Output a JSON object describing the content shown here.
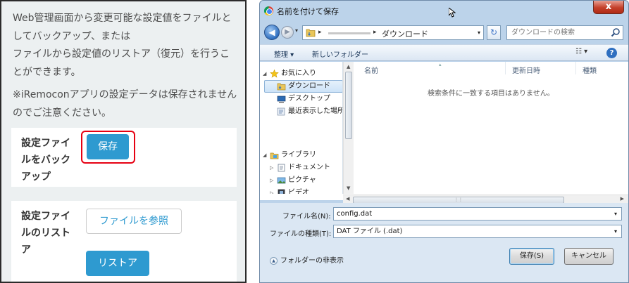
{
  "left": {
    "description_1": "Web管理画面から変更可能な設定値をファイルとしてバックアップ、または\nファイルから設定値のリストア（復元）を行うことができます。",
    "description_2": "※iRemoconアプリの設定データは保存されませんのでご注意ください。",
    "backup": {
      "label": "設定ファイ\nルをバック\nアップ",
      "save_button": "保存"
    },
    "restore": {
      "label": "設定ファイ\nルのリスト\nア",
      "browse_button": "ファイルを参照",
      "restore_button": "リストア"
    },
    "colors": {
      "accent": "#2e9ad0",
      "highlight": "#e60012"
    }
  },
  "dialog": {
    "title": "名前を付けて保存",
    "close_label": "x",
    "address": {
      "current": "ダウンロード"
    },
    "search_placeholder": "ダウンロードの検索",
    "toolbar": {
      "organize": "整理 ▾",
      "new_folder": "新しいフォルダー"
    },
    "nav_tree": [
      {
        "label": "お気に入り",
        "icon": "star-icon"
      },
      {
        "label": "ダウンロード",
        "icon": "downloads-folder-icon",
        "selected": true
      },
      {
        "label": "デスクトップ",
        "icon": "desktop-icon"
      },
      {
        "label": "最近表示した場所",
        "icon": "recent-places-icon"
      },
      {
        "label": "ライブラリ",
        "icon": "library-icon"
      },
      {
        "label": "ドキュメント",
        "icon": "documents-icon"
      },
      {
        "label": "ピクチャ",
        "icon": "pictures-icon"
      },
      {
        "label": "ビデオ",
        "icon": "videos-icon"
      }
    ],
    "columns": [
      "名前",
      "更新日時",
      "種類"
    ],
    "empty_message": "検索条件に一致する項目はありません。",
    "filename_label": "ファイル名(N):",
    "filename_value": "config.dat",
    "filetype_label": "ファイルの種類(T):",
    "filetype_value": "DAT ファイル (.dat)",
    "hide_folders": "フォルダーの非表示",
    "save_button": "保存(S)",
    "cancel_button": "キャンセル"
  }
}
